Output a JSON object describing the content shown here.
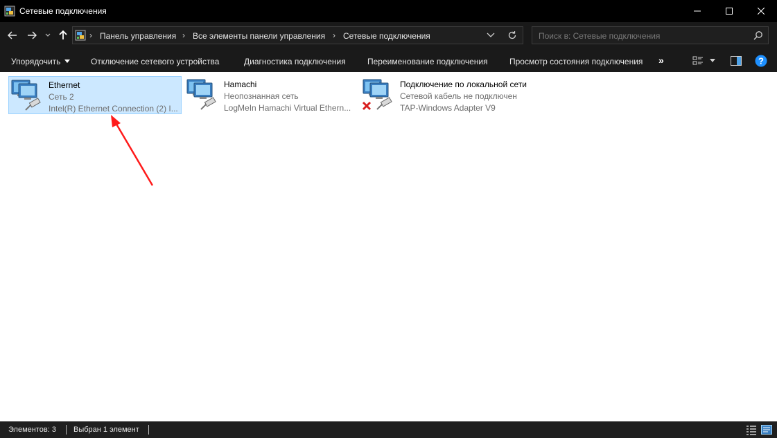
{
  "window": {
    "title": "Сетевые подключения"
  },
  "navigation": {
    "breadcrumbs": [
      "Панель управления",
      "Все элементы панели управления",
      "Сетевые подключения"
    ],
    "search_placeholder": "Поиск в: Сетевые подключения"
  },
  "commands": {
    "organize": "Упорядочить",
    "disable": "Отключение сетевого устройства",
    "diagnose": "Диагностика подключения",
    "rename": "Переименование подключения",
    "view_status": "Просмотр состояния подключения",
    "more": "»"
  },
  "connections": [
    {
      "name": "Ethernet",
      "status": "Сеть 2",
      "device": "Intel(R) Ethernet Connection (2) I...",
      "selected": true,
      "disconnected": false
    },
    {
      "name": "Hamachi",
      "status": "Неопознанная сеть",
      "device": "LogMeIn Hamachi Virtual Ethern...",
      "selected": false,
      "disconnected": false
    },
    {
      "name": "Подключение по локальной сети",
      "status": "Сетевой кабель не подключен",
      "device": "TAP-Windows Adapter V9",
      "selected": false,
      "disconnected": true
    }
  ],
  "statusbar": {
    "count": "Элементов: 3",
    "selected": "Выбран 1 элемент"
  },
  "colors": {
    "selection_bg": "#cce8ff",
    "selection_border": "#99d1ff",
    "annotation_arrow": "#ff1a1a",
    "help_icon": "#1e90ff"
  }
}
